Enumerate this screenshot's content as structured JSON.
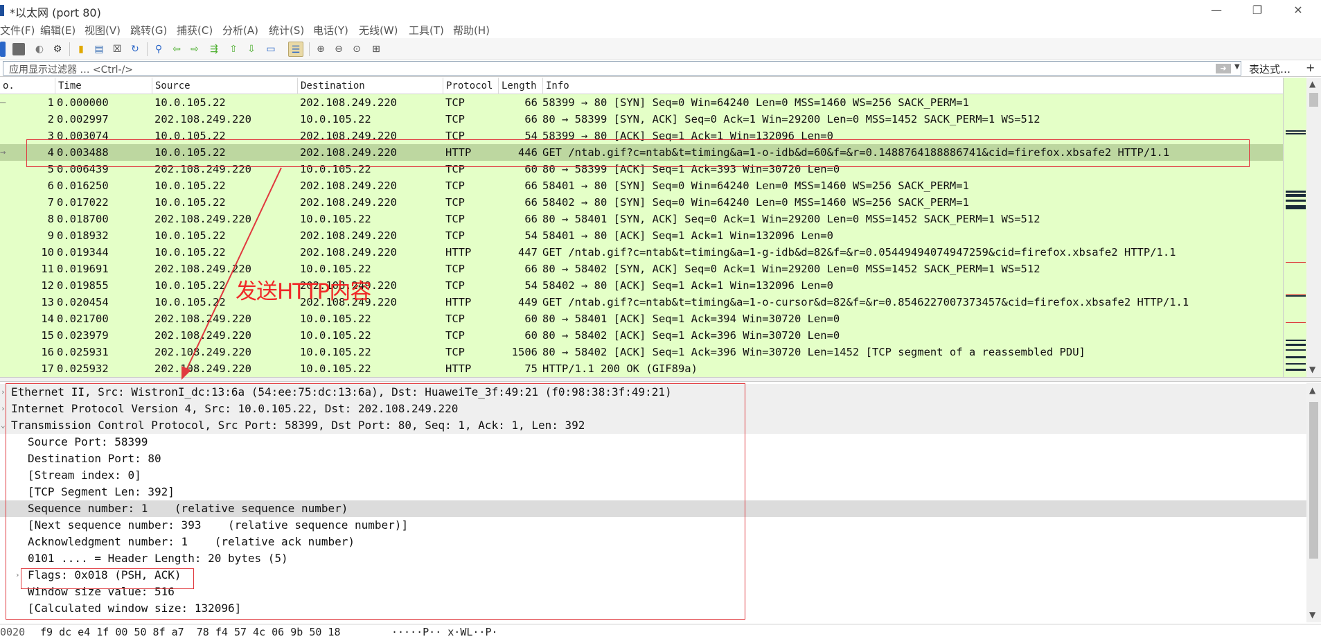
{
  "window": {
    "title": "*以太网 (port 80)",
    "controls": {
      "minimize": "—",
      "maximize": "❐",
      "close": "✕"
    }
  },
  "menu": {
    "items": [
      "文件(F)",
      "编辑(E)",
      "视图(V)",
      "跳转(G)",
      "捕获(C)",
      "分析(A)",
      "统计(S)",
      "电话(Y)",
      "无线(W)",
      "工具(T)",
      "帮助(H)"
    ]
  },
  "toolbar": {
    "icons": [
      "start-capture-icon",
      "stop-capture-icon",
      "restart-capture-icon",
      "capture-options-icon",
      "open-file-icon",
      "save-file-icon",
      "close-file-icon",
      "reload-file-icon",
      "find-packet-icon",
      "go-back-icon",
      "go-forward-icon",
      "go-to-packet-icon",
      "go-first-icon",
      "go-last-icon",
      "autoscroll-icon",
      "colorize-icon",
      "zoom-in-icon",
      "zoom-out-icon",
      "zoom-normal-icon",
      "resize-columns-icon"
    ]
  },
  "filter": {
    "placeholder": "应用显示过滤器 … <Ctrl-/>",
    "apply_icon": "arrow-right-icon",
    "expression_label": "表达式…",
    "add_label": "+"
  },
  "packet_list": {
    "columns": [
      "o.",
      "Time",
      "Source",
      "Destination",
      "Protocol",
      "Length",
      "Info"
    ],
    "selected_index": 3,
    "rows": [
      {
        "no": "1",
        "time": "0.000000",
        "src": "10.0.105.22",
        "dst": "202.108.249.220",
        "proto": "TCP",
        "len": "66",
        "info": "58399 → 80 [SYN] Seq=0 Win=64240 Len=0 MSS=1460 WS=256 SACK_PERM=1"
      },
      {
        "no": "2",
        "time": "0.002997",
        "src": "202.108.249.220",
        "dst": "10.0.105.22",
        "proto": "TCP",
        "len": "66",
        "info": "80 → 58399 [SYN, ACK] Seq=0 Ack=1 Win=29200 Len=0 MSS=1452 SACK_PERM=1 WS=512"
      },
      {
        "no": "3",
        "time": "0.003074",
        "src": "10.0.105.22",
        "dst": "202.108.249.220",
        "proto": "TCP",
        "len": "54",
        "info": "58399 → 80 [ACK] Seq=1 Ack=1 Win=132096 Len=0"
      },
      {
        "no": "4",
        "time": "0.003488",
        "src": "10.0.105.22",
        "dst": "202.108.249.220",
        "proto": "HTTP",
        "len": "446",
        "info": "GET /ntab.gif?c=ntab&t=timing&a=1-o-idb&d=60&f=&r=0.1488764188886741&cid=firefox.xbsafe2 HTTP/1.1"
      },
      {
        "no": "5",
        "time": "0.006439",
        "src": "202.108.249.220",
        "dst": "10.0.105.22",
        "proto": "TCP",
        "len": "60",
        "info": "80 → 58399 [ACK] Seq=1 Ack=393 Win=30720 Len=0"
      },
      {
        "no": "6",
        "time": "0.016250",
        "src": "10.0.105.22",
        "dst": "202.108.249.220",
        "proto": "TCP",
        "len": "66",
        "info": "58401 → 80 [SYN] Seq=0 Win=64240 Len=0 MSS=1460 WS=256 SACK_PERM=1"
      },
      {
        "no": "7",
        "time": "0.017022",
        "src": "10.0.105.22",
        "dst": "202.108.249.220",
        "proto": "TCP",
        "len": "66",
        "info": "58402 → 80 [SYN] Seq=0 Win=64240 Len=0 MSS=1460 WS=256 SACK_PERM=1"
      },
      {
        "no": "8",
        "time": "0.018700",
        "src": "202.108.249.220",
        "dst": "10.0.105.22",
        "proto": "TCP",
        "len": "66",
        "info": "80 → 58401 [SYN, ACK] Seq=0 Ack=1 Win=29200 Len=0 MSS=1452 SACK_PERM=1 WS=512"
      },
      {
        "no": "9",
        "time": "0.018932",
        "src": "10.0.105.22",
        "dst": "202.108.249.220",
        "proto": "TCP",
        "len": "54",
        "info": "58401 → 80 [ACK] Seq=1 Ack=1 Win=132096 Len=0"
      },
      {
        "no": "10",
        "time": "0.019344",
        "src": "10.0.105.22",
        "dst": "202.108.249.220",
        "proto": "HTTP",
        "len": "447",
        "info": "GET /ntab.gif?c=ntab&t=timing&a=1-g-idb&d=82&f=&r=0.05449494074947259&cid=firefox.xbsafe2 HTTP/1.1"
      },
      {
        "no": "11",
        "time": "0.019691",
        "src": "202.108.249.220",
        "dst": "10.0.105.22",
        "proto": "TCP",
        "len": "66",
        "info": "80 → 58402 [SYN, ACK] Seq=0 Ack=1 Win=29200 Len=0 MSS=1452 SACK_PERM=1 WS=512"
      },
      {
        "no": "12",
        "time": "0.019855",
        "src": "10.0.105.22",
        "dst": "202.108.249.220",
        "proto": "TCP",
        "len": "54",
        "info": "58402 → 80 [ACK] Seq=1 Ack=1 Win=132096 Len=0"
      },
      {
        "no": "13",
        "time": "0.020454",
        "src": "10.0.105.22",
        "dst": "202.108.249.220",
        "proto": "HTTP",
        "len": "449",
        "info": "GET /ntab.gif?c=ntab&t=timing&a=1-o-cursor&d=82&f=&r=0.8546227007373457&cid=firefox.xbsafe2 HTTP/1.1"
      },
      {
        "no": "14",
        "time": "0.021700",
        "src": "202.108.249.220",
        "dst": "10.0.105.22",
        "proto": "TCP",
        "len": "60",
        "info": "80 → 58401 [ACK] Seq=1 Ack=394 Win=30720 Len=0"
      },
      {
        "no": "15",
        "time": "0.023979",
        "src": "202.108.249.220",
        "dst": "10.0.105.22",
        "proto": "TCP",
        "len": "60",
        "info": "80 → 58402 [ACK] Seq=1 Ack=396 Win=30720 Len=0"
      },
      {
        "no": "16",
        "time": "0.025931",
        "src": "202.108.249.220",
        "dst": "10.0.105.22",
        "proto": "TCP",
        "len": "1506",
        "info": "80 → 58402 [ACK] Seq=1 Ack=396 Win=30720 Len=1452 [TCP segment of a reassembled PDU]"
      },
      {
        "no": "17",
        "time": "0.025932",
        "src": "202.108.249.220",
        "dst": "10.0.105.22",
        "proto": "HTTP",
        "len": "75",
        "info": "HTTP/1.1 200 OK  (GIF89a)"
      }
    ]
  },
  "details": {
    "lines": [
      {
        "text": "Ethernet II, Src: WistronI_dc:13:6a (54:ee:75:dc:13:6a), Dst: HuaweiTe_3f:49:21 (f0:98:38:3f:49:21)",
        "indent": 0,
        "expander": "›",
        "style": "hdr"
      },
      {
        "text": "Internet Protocol Version 4, Src: 10.0.105.22, Dst: 202.108.249.220",
        "indent": 0,
        "expander": "›",
        "style": "hdr"
      },
      {
        "text": "Transmission Control Protocol, Src Port: 58399, Dst Port: 80, Seq: 1, Ack: 1, Len: 392",
        "indent": 0,
        "expander": "⌄",
        "style": "hdr"
      },
      {
        "text": "Source Port: 58399",
        "indent": 1,
        "expander": "",
        "style": ""
      },
      {
        "text": "Destination Port: 80",
        "indent": 1,
        "expander": "",
        "style": ""
      },
      {
        "text": "[Stream index: 0]",
        "indent": 1,
        "expander": "",
        "style": ""
      },
      {
        "text": "[TCP Segment Len: 392]",
        "indent": 1,
        "expander": "",
        "style": ""
      },
      {
        "text": "Sequence number: 1    (relative sequence number)",
        "indent": 1,
        "expander": "",
        "style": "hl"
      },
      {
        "text": "[Next sequence number: 393    (relative sequence number)]",
        "indent": 1,
        "expander": "",
        "style": ""
      },
      {
        "text": "Acknowledgment number: 1    (relative ack number)",
        "indent": 1,
        "expander": "",
        "style": ""
      },
      {
        "text": "0101 .... = Header Length: 20 bytes (5)",
        "indent": 1,
        "expander": "",
        "style": ""
      },
      {
        "text": "Flags: 0x018 (PSH, ACK)",
        "indent": 1,
        "expander": "›",
        "style": ""
      },
      {
        "text": "Window size value: 516",
        "indent": 1,
        "expander": "",
        "style": ""
      },
      {
        "text": "[Calculated window size: 132096]",
        "indent": 1,
        "expander": "",
        "style": ""
      }
    ]
  },
  "bytes_pane": {
    "offset": "0020",
    "hex": "f9 dc e4 1f 00 50 8f a7  78 f4 57 4c 06 9b 50 18",
    "ascii": "·····P·· x·WL··P·"
  },
  "annotation": {
    "label": "发送HTTP内容",
    "color": "#f02828"
  }
}
